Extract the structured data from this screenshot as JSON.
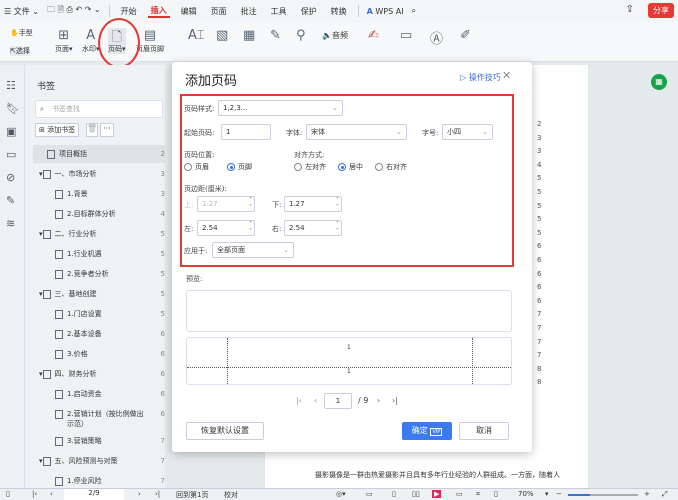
{
  "titlebar": {
    "file_menu": "文件",
    "tabs": [
      "开始",
      "插入",
      "编辑",
      "页面",
      "批注",
      "工具",
      "保护",
      "转换"
    ],
    "active_tab": "插入",
    "wps_ai": "WPS AI",
    "share": "分享"
  },
  "ribbon": {
    "hand": "手型",
    "select": "选择",
    "page": "页面",
    "watermark": "水印",
    "page_number": "页码",
    "header_footer": "页眉页脚",
    "audio": "音频"
  },
  "sidebar": {
    "title": "书签",
    "search_placeholder": "书签查找",
    "add_bookmark": "添加书签",
    "more": "···",
    "items": [
      {
        "label": "项目概括",
        "page": "2",
        "level": 0,
        "selected": true
      },
      {
        "label": "一、市场分析",
        "page": "3",
        "level": 0,
        "expandable": true
      },
      {
        "label": "1.背景",
        "page": "3",
        "level": 1
      },
      {
        "label": "2.目标群体分析",
        "page": "4",
        "level": 1
      },
      {
        "label": "二、行业分析",
        "page": "5",
        "level": 0,
        "expandable": true
      },
      {
        "label": "1.行业机遇",
        "page": "5",
        "level": 1
      },
      {
        "label": "2.竞争者分析",
        "page": "5",
        "level": 1
      },
      {
        "label": "三、基地创建",
        "page": "5",
        "level": 0,
        "expandable": true
      },
      {
        "label": "1.门店设置",
        "page": "5",
        "level": 1
      },
      {
        "label": "2.基本设备",
        "page": "6",
        "level": 1
      },
      {
        "label": "3.价格",
        "page": "6",
        "level": 1
      },
      {
        "label": "四、财务分析",
        "page": "6",
        "level": 0,
        "expandable": true
      },
      {
        "label": "1.启动资金",
        "page": "6",
        "level": 1
      },
      {
        "label": "2.营销计划（按比例做出示范）",
        "page": "6",
        "level": 1
      },
      {
        "label": "3.营销策略",
        "page": "7",
        "level": 1
      },
      {
        "label": "五、风险预测与对策",
        "page": "7",
        "level": 0,
        "expandable": true
      },
      {
        "label": "1.停业风险",
        "page": "7",
        "level": 1
      }
    ]
  },
  "document": {
    "toc_pages": [
      "2",
      "3",
      "3",
      "4",
      "5",
      "5",
      "5",
      "5",
      "5",
      "6",
      "6",
      "6",
      "6",
      "6",
      "7",
      "7",
      "7",
      "7",
      "8",
      "8"
    ],
    "body_text": "摄影摄像是一群由热爱摄影并且具有多年行业经验的人群组成。一方面，随着人"
  },
  "dialog": {
    "title": "添加页码",
    "tips": "操作技巧",
    "style_label": "页码样式:",
    "style_value": "1,2,3...",
    "start_label": "起始页码:",
    "start_value": "1",
    "font_label": "字体:",
    "font_value": "宋体",
    "size_label": "字号:",
    "size_value": "小四",
    "position_label": "页码位置:",
    "pos_header": "页眉",
    "pos_footer": "页脚",
    "position_selected": "页脚",
    "align_label": "对齐方式:",
    "align_left": "左对齐",
    "align_center": "居中",
    "align_right": "右对齐",
    "align_selected": "居中",
    "margin_label": "页边距(厘米):",
    "top_label": "上:",
    "top_value": "1.27",
    "bottom_label": "下:",
    "bottom_value": "1.27",
    "left_label": "左:",
    "left_value": "2.54",
    "right_label": "右:",
    "right_value": "2.54",
    "apply_label": "应用于:",
    "apply_value": "全部页面",
    "preview_label": "预览:",
    "preview_num_top": "1",
    "preview_num_bottom": "1",
    "pager_current": "1",
    "pager_total": "/ 9",
    "reset": "恢复默认设置",
    "ok": "确定",
    "vip": "VIP",
    "cancel": "取消"
  },
  "statusbar": {
    "page": "2/9",
    "back": "回到第1页",
    "proofread": "校对",
    "zoom": "70%"
  },
  "colors": {
    "accent": "#3b7bf0",
    "highlight": "#e53935",
    "active_tab": "#d33"
  }
}
